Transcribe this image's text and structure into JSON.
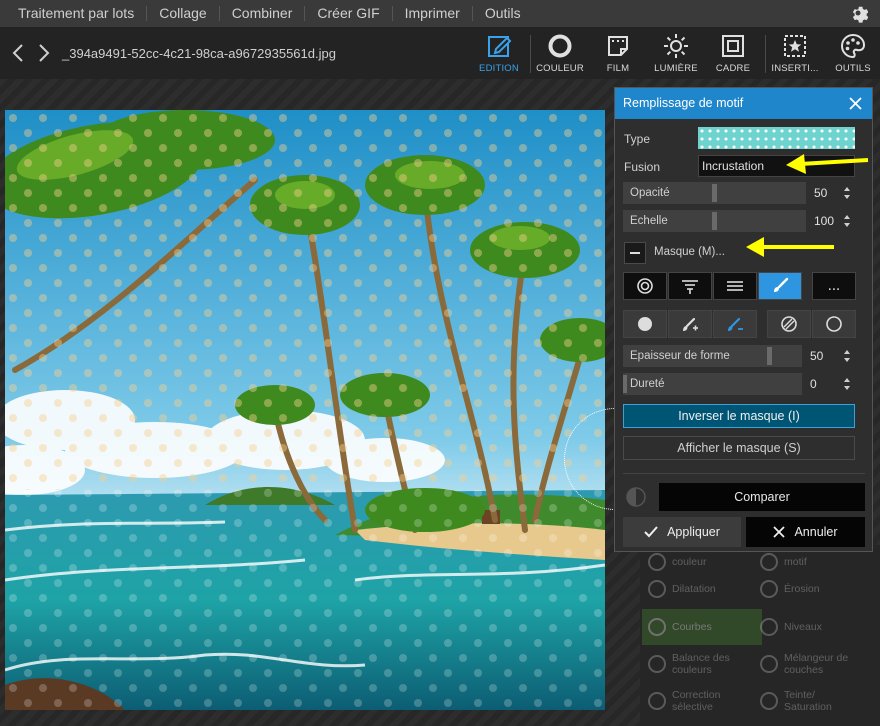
{
  "menu": {
    "items": [
      "Traitement par lots",
      "Collage",
      "Combiner",
      "Créer GIF",
      "Imprimer",
      "Outils"
    ]
  },
  "toolbar": {
    "filename": "_394a9491-52cc-4c21-98ca-a9672935561d.jpg",
    "tools": [
      {
        "label": "EDITION",
        "icon": "edit-icon",
        "active": true
      },
      {
        "label": "COULEUR",
        "icon": "color-circle-icon"
      },
      {
        "label": "FILM",
        "icon": "film-icon"
      },
      {
        "label": "LUMIÈRE",
        "icon": "sun-icon"
      },
      {
        "label": "CADRE",
        "icon": "frame-icon"
      },
      {
        "label": "INSERTI...",
        "icon": "insert-star-icon"
      },
      {
        "label": "OUTILS",
        "icon": "palette-icon"
      }
    ],
    "accent_color": "#3aa2ea"
  },
  "dialog": {
    "title": "Remplissage de motif",
    "type_label": "Type",
    "fusion_label": "Fusion",
    "fusion_value": "Incrustation",
    "opacity_label": "Opacité",
    "opacity_value": "50",
    "scale_label": "Echelle",
    "scale_value": "100",
    "mask_label": "Masque (M)...",
    "shape_thickness_label": "Epaisseur de forme",
    "shape_thickness_value": "50",
    "hardness_label": "Dureté",
    "hardness_value": "0",
    "invert_mask": "Inverser le masque (I)",
    "show_mask": "Afficher le masque (S)",
    "compare": "Comparer",
    "apply": "Appliquer",
    "cancel": "Annuler",
    "more_button": "...",
    "title_color": "#1f86cc",
    "pattern_color": "#6fd3cf",
    "annotation_arrow_color": "#ffff00"
  },
  "right_panel": {
    "items": [
      {
        "label": "couleur"
      },
      {
        "label": "motif"
      },
      {
        "label": "Dilatation"
      },
      {
        "label": "Érosion"
      },
      {
        "label": "Courbes"
      },
      {
        "label": "Niveaux"
      },
      {
        "label": "Balance des\ncouleurs"
      },
      {
        "label": "Mélangeur de\ncouches"
      },
      {
        "label": "Correction\nsélective"
      },
      {
        "label": "Teinte/\nSaturation"
      }
    ]
  }
}
